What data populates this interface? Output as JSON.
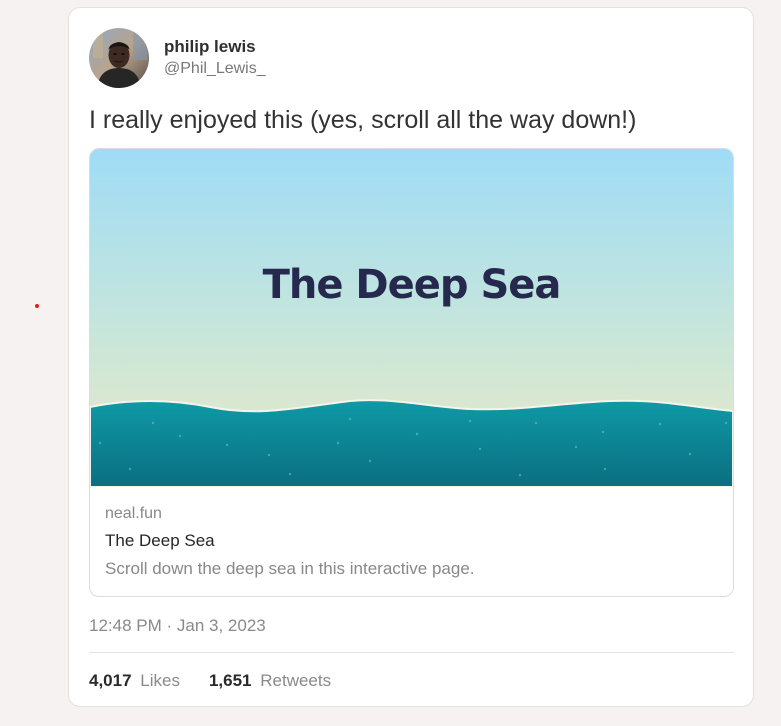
{
  "tweet": {
    "author": {
      "name": "philip lewis",
      "handle": "@Phil_Lewis_"
    },
    "text": "I really enjoyed this (yes, scroll all the way down!)",
    "link_card": {
      "image_title": "The Deep Sea",
      "domain": "neal.fun",
      "title": "The Deep Sea",
      "description": "Scroll down the deep sea in this interactive page."
    },
    "timestamp": "12:48 PM · Jan 3, 2023",
    "stats": {
      "likes_count": "4,017",
      "likes_label": "Likes",
      "retweets_count": "1,651",
      "retweets_label": "Retweets"
    }
  },
  "colors": {
    "page_background": "#f6f2f1",
    "card_background": "#ffffff",
    "sky_top": "#9fdcf6",
    "sky_bottom": "#ede9c6",
    "sea_top": "#0f9aa6",
    "sea_bottom": "#0a6e80",
    "title_color": "#26284d",
    "indicator_dot": "#e0201c"
  }
}
